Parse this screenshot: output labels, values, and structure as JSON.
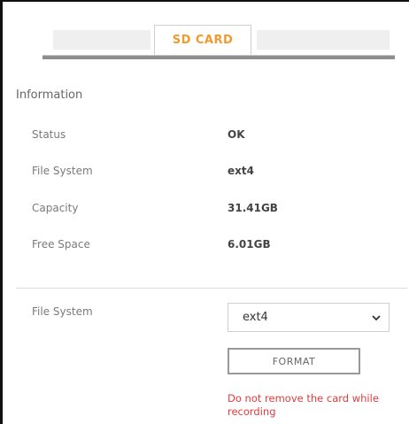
{
  "tabs": {
    "active_label": "SD CARD"
  },
  "information": {
    "title": "Information",
    "rows": [
      {
        "label": "Status",
        "value": "OK"
      },
      {
        "label": "File System",
        "value": "ext4"
      },
      {
        "label": "Capacity",
        "value": "31.41GB"
      },
      {
        "label": "Free Space",
        "value": "6.01GB"
      }
    ]
  },
  "format_section": {
    "file_system_label": "File System",
    "file_system_selected": "ext4",
    "format_button": "FORMAT",
    "warning": "Do not remove the card while recording"
  },
  "colors": {
    "accent": "#f29a2e",
    "warning": "#e23b3b"
  }
}
